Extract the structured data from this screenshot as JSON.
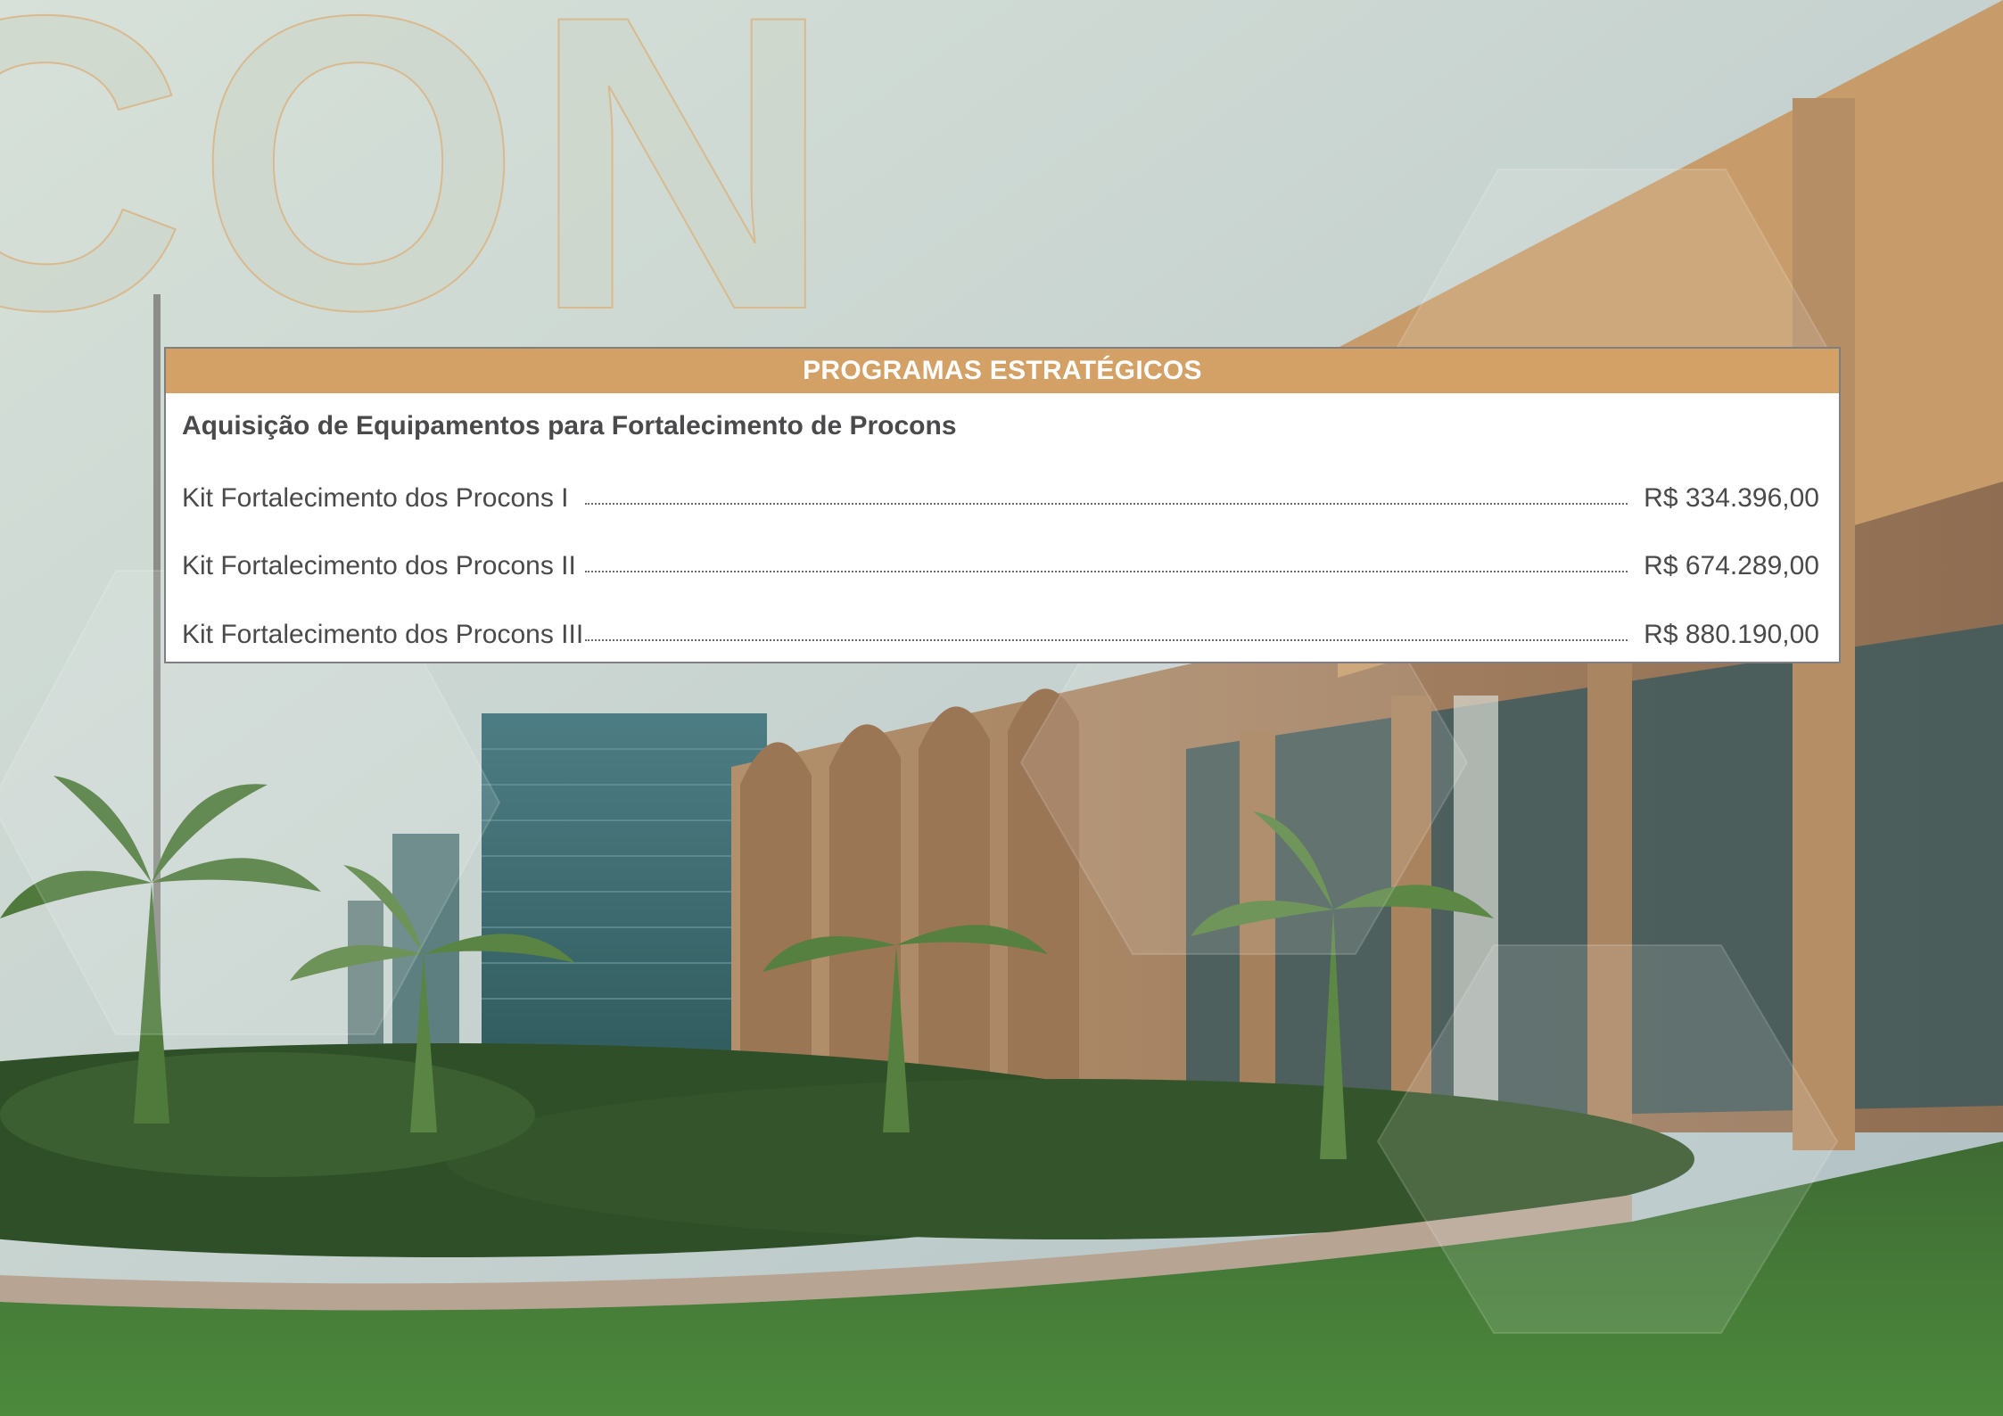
{
  "colors": {
    "accent": "#d3a066",
    "text": "#4a4a4c",
    "border": "#7d7f82"
  },
  "background": {
    "watermark_text": "CON"
  },
  "table": {
    "header": "PROGRAMAS ESTRATÉGICOS",
    "section_title": "Aquisição de Equipamentos para Fortalecimento de Procons",
    "rows": [
      {
        "label": "Kit Fortalecimento dos Procons I",
        "value": "R$ 334.396,00"
      },
      {
        "label": "Kit Fortalecimento dos Procons II",
        "value": "R$ 674.289,00"
      },
      {
        "label": "Kit Fortalecimento dos Procons III",
        "value": "R$ 880.190,00"
      }
    ]
  }
}
